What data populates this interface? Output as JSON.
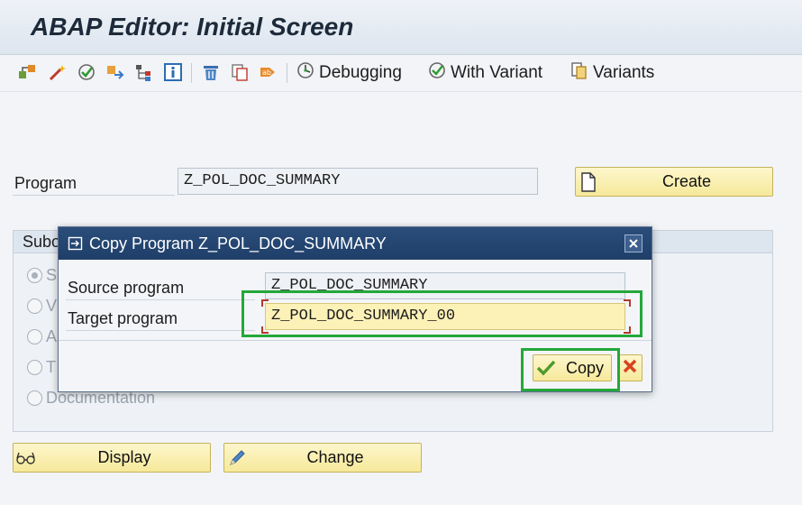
{
  "app": {
    "title": "ABAP Editor: Initial Screen"
  },
  "toolbar": {
    "icons": [
      "object-list-icon",
      "magic-wand-icon",
      "check-icon",
      "where-used-icon",
      "hierarchy-icon",
      "info-icon",
      "delete-icon",
      "copy-icon",
      "rename-icon"
    ],
    "debugging_label": "Debugging",
    "with_variant_label": "With Variant",
    "variants_label": "Variants"
  },
  "main": {
    "program_label": "Program",
    "program_value": "Z_POL_DOC_SUMMARY",
    "create_label": "Create",
    "subobjects_title": "Subo",
    "radio_fragments": [
      "S",
      "V",
      "A",
      "T"
    ],
    "documentation_label": "Documentation",
    "display_label": "Display",
    "change_label": "Change"
  },
  "dialog": {
    "title": "Copy Program Z_POL_DOC_SUMMARY",
    "source_label": "Source program",
    "source_value": "Z_POL_DOC_SUMMARY",
    "target_label": "Target program",
    "target_value": "Z_POL_DOC_SUMMARY_00",
    "copy_label": "Copy"
  },
  "colors": {
    "highlight": "#23a83a",
    "dialog_title_bg": "#2a4d7a",
    "button_bg": "#f6e99a"
  }
}
